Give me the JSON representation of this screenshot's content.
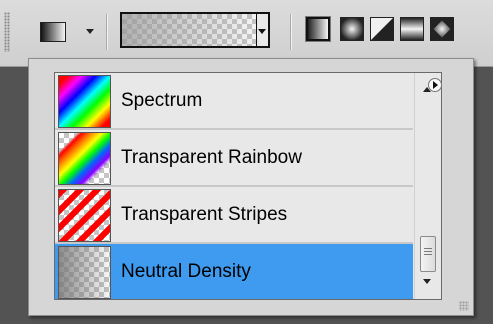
{
  "option_bar": {
    "preset_picker_icon": "gradient-preset-icon",
    "preset_arrow_icon": "chevron-down-icon",
    "gradient_preview": "neutral-density-gradient",
    "gradient_types": [
      {
        "name": "linear-gradient-icon",
        "selected": true
      },
      {
        "name": "radial-gradient-icon",
        "selected": false
      },
      {
        "name": "angle-gradient-icon",
        "selected": false
      },
      {
        "name": "reflected-gradient-icon",
        "selected": false
      },
      {
        "name": "diamond-gradient-icon",
        "selected": false
      }
    ]
  },
  "picker": {
    "menu_icon": "play-circle-icon",
    "items": [
      {
        "label": "Spectrum",
        "swatch": "spectrum",
        "selected": false
      },
      {
        "label": "Transparent Rainbow",
        "swatch": "transparent-rainbow",
        "selected": false
      },
      {
        "label": "Transparent Stripes",
        "swatch": "transparent-stripes",
        "selected": false
      },
      {
        "label": "Neutral Density",
        "swatch": "neutral-density",
        "selected": true
      }
    ],
    "scrollbar": {
      "position": 0.9
    }
  },
  "colors": {
    "selection": "#3e9bf0",
    "panel_bg": "#d6d6d6",
    "workspace_bg": "#535353",
    "list_bg": "#e8e8e8"
  }
}
